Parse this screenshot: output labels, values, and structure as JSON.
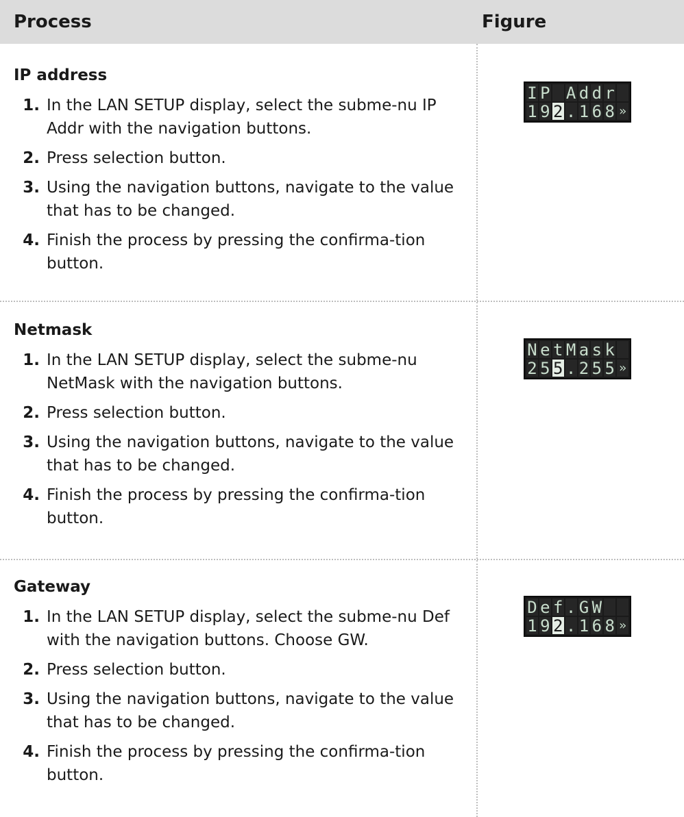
{
  "header": {
    "process_label": "Process",
    "figure_label": "Figure"
  },
  "sections": [
    {
      "title": "IP address",
      "steps": [
        {
          "num": "1.",
          "text": "In the LAN SETUP display, select the subme-nu IP Addr with the navigation buttons."
        },
        {
          "num": "2.",
          "text": "Press selection button."
        },
        {
          "num": "3.",
          "text": "Using the navigation buttons, navigate to the value that has to be changed."
        },
        {
          "num": "4.",
          "text": "Finish the process by pressing the confirma-tion button."
        }
      ],
      "lcd": {
        "line1": [
          "I",
          "P",
          " ",
          "A",
          "d",
          "d",
          "r",
          " "
        ],
        "line2": [
          "1",
          "9",
          "2",
          ".",
          "1",
          "6",
          "8",
          "»"
        ],
        "cursor_col": 2
      }
    },
    {
      "title": "Netmask",
      "steps": [
        {
          "num": "1.",
          "text": "In the LAN SETUP display, select the subme-nu NetMask with the navigation buttons."
        },
        {
          "num": "2.",
          "text": "Press selection button."
        },
        {
          "num": "3.",
          "text": "Using the navigation buttons, navigate to the value that has to be changed."
        },
        {
          "num": "4.",
          "text": "Finish the process by pressing the confirma-tion button."
        }
      ],
      "lcd": {
        "line1": [
          "N",
          "e",
          "t",
          "M",
          "a",
          "s",
          "k",
          " "
        ],
        "line2": [
          "2",
          "5",
          "5",
          ".",
          "2",
          "5",
          "5",
          "»"
        ],
        "cursor_col": 2
      }
    },
    {
      "title": "Gateway",
      "steps": [
        {
          "num": "1.",
          "text": "In the LAN SETUP display, select the subme-nu Def with the navigation buttons. Choose GW."
        },
        {
          "num": "2.",
          "text": "Press selection button."
        },
        {
          "num": "3.",
          "text": "Using the navigation buttons, navigate to the value that has to be changed."
        },
        {
          "num": "4.",
          "text": "Finish the process by pressing the confirma-tion button."
        }
      ],
      "lcd": {
        "line1": [
          "D",
          "e",
          "f",
          ".",
          "G",
          "W",
          " ",
          " "
        ],
        "line2": [
          "1",
          "9",
          "2",
          ".",
          "1",
          "6",
          "8",
          "»"
        ],
        "cursor_col": 2
      }
    }
  ]
}
